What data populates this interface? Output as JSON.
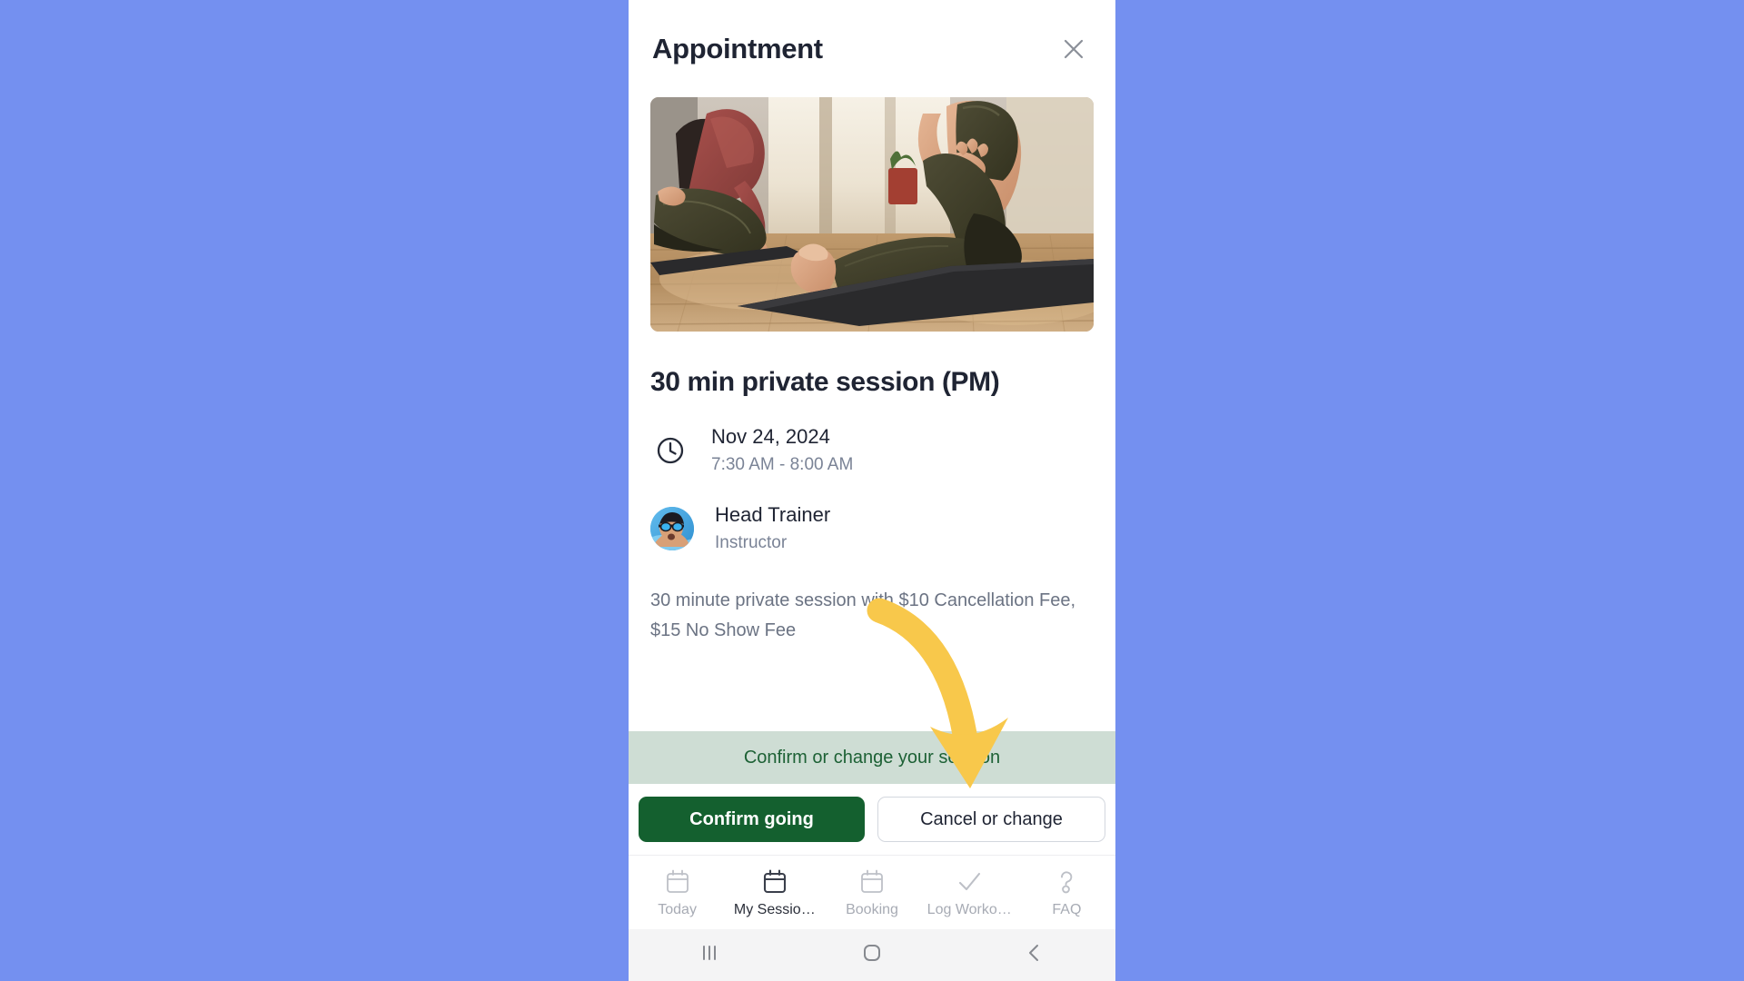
{
  "background": {
    "color": "#7490f0"
  },
  "modal": {
    "title": "Appointment",
    "close_icon": "close-icon",
    "hero": {
      "icon": "yoga-stretching-photo",
      "alt": "Two women stretching on yoga mats on a wooden floor"
    },
    "session_title": "30 min private session (PM)",
    "info": [
      {
        "icon": "clock-icon",
        "primary": "Nov 24, 2024",
        "secondary": "7:30 AM - 8:00 AM"
      },
      {
        "icon": "avatar",
        "primary": "Head Trainer",
        "secondary": "Instructor"
      }
    ],
    "description": "30 minute private session with $10 Cancellation Fee, $15 No Show Fee",
    "status_banner": {
      "text": "Confirm or change your session",
      "background": "#ceddd4",
      "text_color": "#1d6135"
    },
    "actions": {
      "primary_label": "Confirm going",
      "primary_color": "#14602f",
      "secondary_label": "Cancel or change"
    }
  },
  "bottom_nav": {
    "items": [
      {
        "label": "Today",
        "icon": "calendar-icon",
        "active": false
      },
      {
        "label": "My Sessio…",
        "icon": "calendar-icon",
        "active": true
      },
      {
        "label": "Booking",
        "icon": "calendar-icon",
        "active": false
      },
      {
        "label": "Log Worko…",
        "icon": "check-icon",
        "active": false
      },
      {
        "label": "FAQ",
        "icon": "question-mark-icon",
        "active": false
      }
    ]
  },
  "system_bar": {
    "recents_icon": "recents-icon",
    "home_icon": "home-icon",
    "back_icon": "back-icon"
  },
  "annotation": {
    "arrow_color": "#f8c84b",
    "points_to": "Cancel or change"
  }
}
